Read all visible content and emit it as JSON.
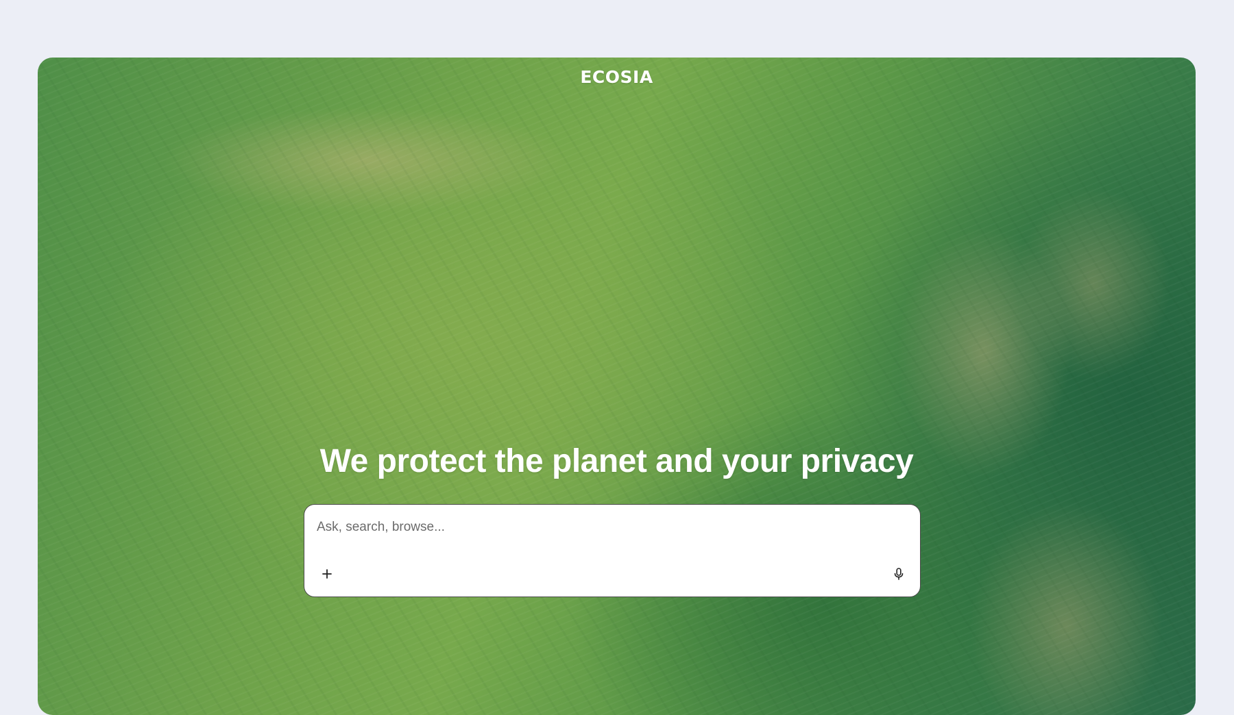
{
  "brand": {
    "logo_text": "ECOSIA"
  },
  "hero": {
    "headline": "We protect the planet and your privacy"
  },
  "search": {
    "placeholder": "Ask, search, browse...",
    "value": "",
    "add_icon": "plus-icon",
    "voice_icon": "microphone-icon"
  },
  "colors": {
    "page_background": "#eceef6",
    "hero_green": "#6ea24a",
    "text_on_hero": "#ffffff"
  }
}
